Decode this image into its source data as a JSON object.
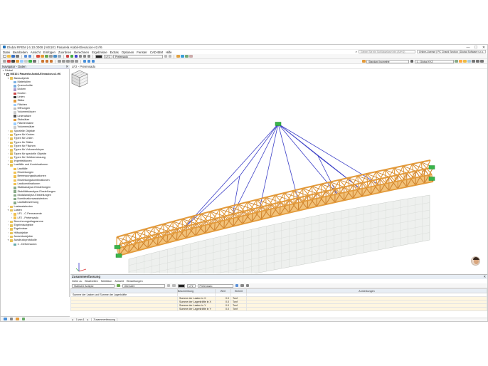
{
  "window": {
    "title": "Dlubal RFEM | 6.10.0008 | MS101 Pasarela Arabil-Elevacion-v2.rf6",
    "controls": [
      "—",
      "☐",
      "✕"
    ]
  },
  "menu": {
    "items": [
      "Datei",
      "Bearbeiten",
      "Ansicht",
      "Einfügen",
      "Zuordnen",
      "Berechnen",
      "Ergebnisse",
      "Extras",
      "Optionen",
      "Fenster",
      "CAD-BIM",
      "Hilfe"
    ],
    "search_placeholder": "Geben Sie ein Schlüsselwort ein (Alt+Q)",
    "license": "Online-License | PC Charid Section | Dlubal Software s.r.o."
  },
  "toolbar1": {
    "load_case_id": "LF2",
    "load_case_name": "Pretensado"
  },
  "toolbar2": {
    "view_combo": "Standard Isometrie",
    "cs_combo": "1 - Global XYZ"
  },
  "navigator": {
    "title": "Navigator - Daten",
    "root": "Dlubal",
    "model": "MS101 Pasarela Arabil-Elevacion-v2.rf6",
    "tree": [
      {
        "label": "Basisobjekte",
        "level": 1,
        "expand": "▾",
        "icon": "folder"
      },
      {
        "label": "Materialien",
        "level": 2,
        "icon": "material"
      },
      {
        "label": "Querschnitte",
        "level": 2,
        "icon": "section"
      },
      {
        "label": "Dicken",
        "level": 2,
        "icon": "thickness"
      },
      {
        "label": "Knoten",
        "level": 2,
        "icon": "node"
      },
      {
        "label": "Linien",
        "level": 2,
        "icon": "line"
      },
      {
        "label": "Stäbe",
        "level": 2,
        "icon": "member"
      },
      {
        "label": "Flächen",
        "level": 2,
        "icon": "surface"
      },
      {
        "label": "Öffnungen",
        "level": 2,
        "icon": "opening"
      },
      {
        "label": "Volumenkörper",
        "level": 2,
        "icon": "solid"
      },
      {
        "label": "Liniensätze",
        "level": 2,
        "icon": "lineset"
      },
      {
        "label": "Stabsätze",
        "level": 2,
        "icon": "memberset"
      },
      {
        "label": "Flächensätze",
        "level": 2,
        "icon": "surfaceset"
      },
      {
        "label": "Volumensätze",
        "level": 2,
        "icon": "solidset"
      },
      {
        "label": "Spezielle Objekte",
        "level": 1,
        "expand": "›",
        "icon": "folder"
      },
      {
        "label": "Typen für Knoten",
        "level": 1,
        "expand": "›",
        "icon": "folder"
      },
      {
        "label": "Typen für Linien",
        "level": 1,
        "expand": "›",
        "icon": "folder"
      },
      {
        "label": "Typen für Stäbe",
        "level": 1,
        "expand": "›",
        "icon": "folder"
      },
      {
        "label": "Typen für Flächen",
        "level": 1,
        "expand": "›",
        "icon": "folder"
      },
      {
        "label": "Typen für Volumenkörper",
        "level": 1,
        "expand": "›",
        "icon": "folder"
      },
      {
        "label": "Typen für spezielle Objekte",
        "level": 1,
        "expand": "›",
        "icon": "folder"
      },
      {
        "label": "Typen für Heldbemessung",
        "level": 1,
        "expand": "›",
        "icon": "folder"
      },
      {
        "label": "Imperfektionen",
        "level": 1,
        "expand": "›",
        "icon": "folder"
      },
      {
        "label": "Lastfälle und Kombinationen",
        "level": 1,
        "expand": "▾",
        "icon": "folder"
      },
      {
        "label": "Lastfälle",
        "level": 2,
        "icon": "lc"
      },
      {
        "label": "Einwirkungen",
        "level": 2,
        "icon": "lc"
      },
      {
        "label": "Bemessungssituationen",
        "level": 2,
        "icon": "lc"
      },
      {
        "label": "Einwirkungskombinationen",
        "level": 2,
        "icon": "lc"
      },
      {
        "label": "Lastkombinationen",
        "level": 2,
        "icon": "lc"
      },
      {
        "label": "Statikanalyse-Einstellungen",
        "level": 2,
        "icon": "settings"
      },
      {
        "label": "Stabilitätsanalyse-Einstellungen",
        "level": 2,
        "icon": "settings"
      },
      {
        "label": "Modalanalyse-Einstellungen",
        "level": 2,
        "icon": "settings"
      },
      {
        "label": "Kombinationsassistenten",
        "level": 2,
        "icon": "settings"
      },
      {
        "label": "Lastfallbeziehung",
        "level": 2,
        "icon": "settings"
      },
      {
        "label": "Lastassistenten",
        "level": 1,
        "expand": "›",
        "icon": "folder"
      },
      {
        "label": "Lasten",
        "level": 1,
        "expand": "▾",
        "icon": "folder"
      },
      {
        "label": "LF1 - C.Permanente",
        "level": 2,
        "expand": "›",
        "icon": "lc"
      },
      {
        "label": "LF2 - Pretensado",
        "level": 2,
        "expand": "›",
        "icon": "lc"
      },
      {
        "label": "Berechnungsdiagramme",
        "level": 1,
        "expand": "›",
        "icon": "folder"
      },
      {
        "label": "Ergebnisobjekte",
        "level": 1,
        "expand": "›",
        "icon": "folder"
      },
      {
        "label": "Ergebnisse",
        "level": 1,
        "expand": "›",
        "icon": "folder"
      },
      {
        "label": "Hilfsobjekte",
        "level": 1,
        "expand": "›",
        "icon": "folder"
      },
      {
        "label": "Ansichtsobjekte",
        "level": 1,
        "expand": "›",
        "icon": "folder"
      },
      {
        "label": "Ausdruckprotokolle",
        "level": 1,
        "expand": "▾",
        "icon": "folder"
      },
      {
        "label": "1 - Deformacion",
        "level": 2,
        "icon": "report"
      }
    ]
  },
  "view": {
    "header": "LF2 - Pretensado"
  },
  "summary": {
    "title": "Zusammenfassung",
    "menu": [
      "Gehe zu",
      "Bearbeiten",
      "Selektion",
      "Ansicht",
      "Einstellungen"
    ],
    "analysis_combo": "Statische Analyse",
    "overview_combo": "Übersicht",
    "lc_id": "LF2",
    "lc_name": "Pretensado",
    "columns": [
      "Beschreibung",
      "Wert",
      "Einheit",
      "Anmerkungen"
    ],
    "group_label": "Summe der Lasten und Summe der Lagerkräfte",
    "rows": [
      {
        "desc": "Summe der Lasten in X",
        "value": "0.0",
        "unit": "Tonf",
        "note": ""
      },
      {
        "desc": "Summe der Lagerkräfte in X",
        "value": "0.0",
        "unit": "Tonf",
        "note": ""
      },
      {
        "desc": "Summe der Lasten in Y",
        "value": "0.0",
        "unit": "Tonf",
        "note": ""
      },
      {
        "desc": "Summe der Lagerkräfte in Y",
        "value": "0.0",
        "unit": "Tonf",
        "note": ""
      }
    ],
    "footer": {
      "pager": "1 von 1",
      "tab": "Zusammenfassung"
    }
  },
  "colors": {
    "truss": "#e39a3a",
    "cable": "#3b3fc7",
    "support": "#39b54a",
    "selection": "#e8eef5"
  }
}
